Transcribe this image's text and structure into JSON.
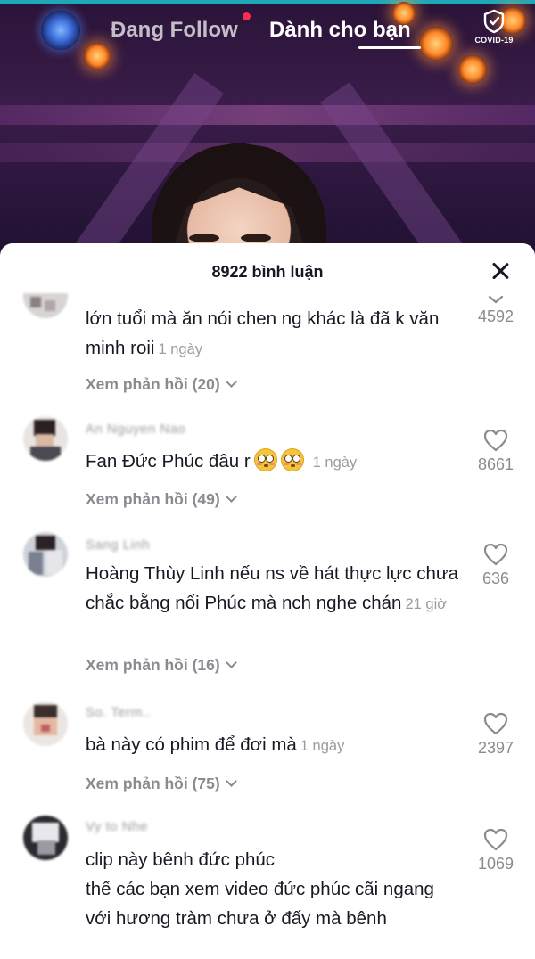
{
  "nav": {
    "following_label": "Đang Follow",
    "for_you_label": "Dành cho bạn",
    "covid_label": "COVID-19"
  },
  "comments_sheet": {
    "count_label": "8922 bình luận"
  },
  "comments": [
    {
      "username": "",
      "text": "lớn tuổi mà ăn nói chen ng khác là đã k văn minh roii",
      "time": "1 ngày",
      "likes": "4592",
      "replies_label": "Xem phản hồi (20)"
    },
    {
      "username": "An Nguyen Nao",
      "text": "Fan Đức Phúc đâu r",
      "emoji": [
        "flushed-face-icon",
        "flushed-face-icon"
      ],
      "time": "1 ngày",
      "likes": "8661",
      "replies_label": "Xem phản hồi (49)"
    },
    {
      "username": "Sang Linh",
      "text": "Hoàng Thùy Linh nếu ns về hát thực lực chưa chắc bằng nổi Phúc mà nch nghe chán",
      "time": "21 giờ",
      "likes": "636",
      "replies_label": "Xem phản hồi (16)"
    },
    {
      "username": "So. Term..",
      "text": "bà này có phim để đơi mà",
      "time": "1 ngày",
      "likes": "2397",
      "replies_label": "Xem phản hồi (75)"
    },
    {
      "username": "Vy to Nhe",
      "text": "clip này bênh đức phúc\nthế các bạn xem video đức phúc cãi ngang với hương tràm chưa ở đấy mà bênh",
      "time": "",
      "likes": "1069",
      "replies_label": ""
    }
  ],
  "colors": {
    "accent_red": "#fe2c55",
    "text_primary": "#161823",
    "text_secondary": "#8a8b91"
  }
}
